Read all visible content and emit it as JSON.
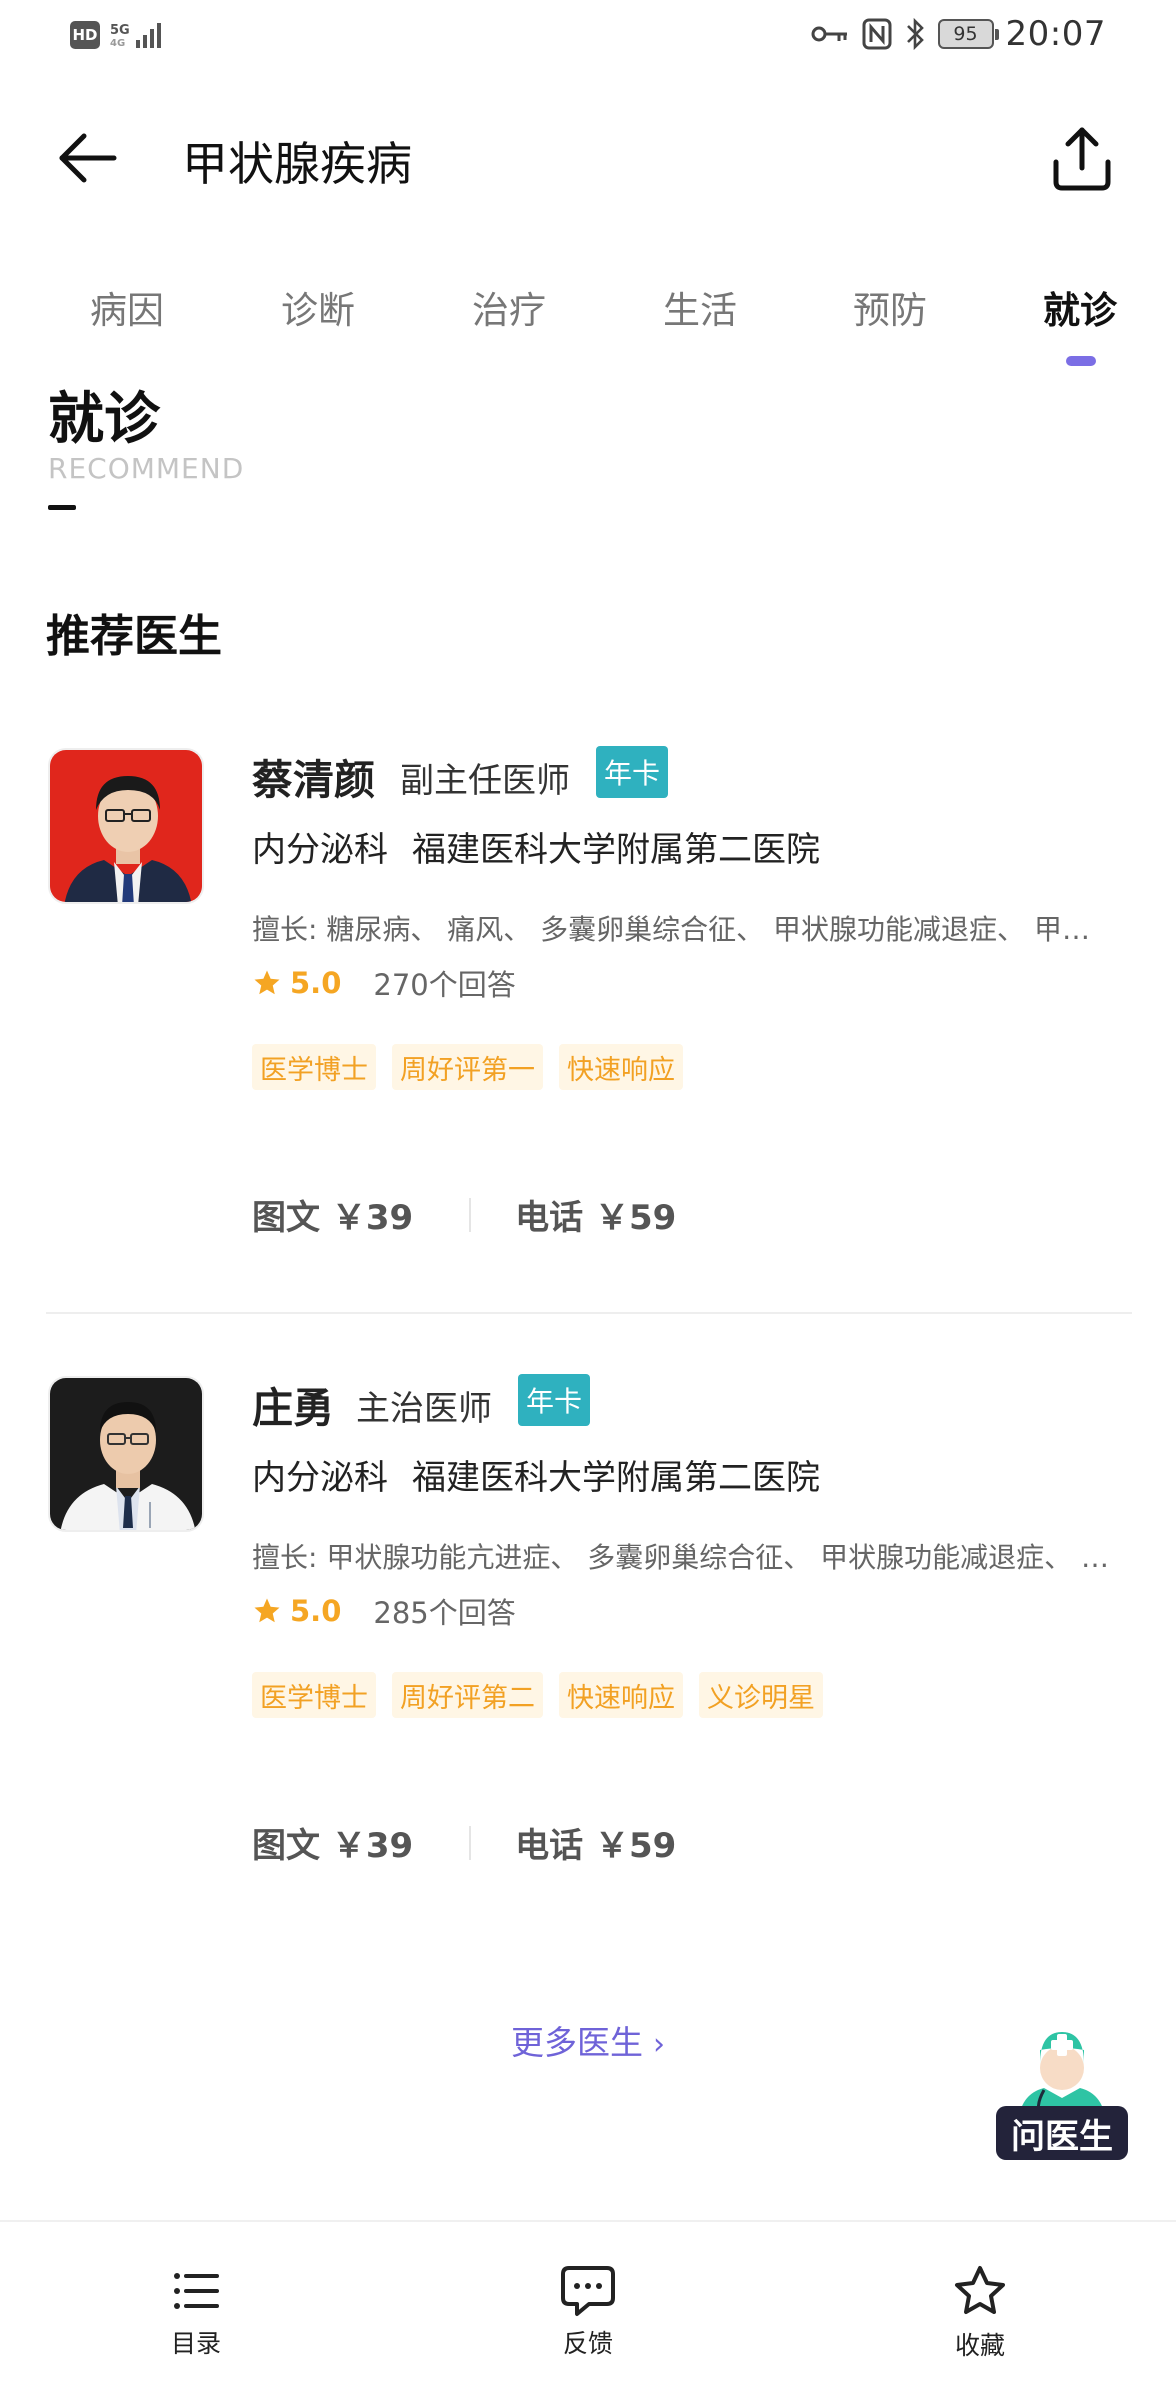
{
  "status_bar": {
    "hd": "HD",
    "network_top": "5G",
    "network_bottom": "4G",
    "battery": "95",
    "time": "20:07"
  },
  "header": {
    "title": "甲状腺疾病"
  },
  "tabs": [
    {
      "label": "病因",
      "active": false
    },
    {
      "label": "诊断",
      "active": false
    },
    {
      "label": "治疗",
      "active": false
    },
    {
      "label": "生活",
      "active": false
    },
    {
      "label": "预防",
      "active": false
    },
    {
      "label": "就诊",
      "active": true
    }
  ],
  "section": {
    "title": "就诊",
    "subtitle": "RECOMMEND",
    "recommend_title": "推荐医生"
  },
  "doctors": [
    {
      "name": "蔡清颜",
      "title": "副主任医师",
      "badge": "年卡",
      "department": "内分泌科",
      "hospital": "福建医科大学附属第二医院",
      "specialty": "擅长:   糖尿病、 痛风、 多囊卵巢综合征、 甲状腺功能减退症、 甲状腺功能亢进症",
      "rating": "5.0",
      "answers": "270个回答",
      "tags": [
        "医学博士",
        "周好评第一",
        "快速响应"
      ],
      "price_text": "图文 ￥39",
      "price_phone": "电话 ￥59",
      "avatar_bg": "#e0261c"
    },
    {
      "name": "庄勇",
      "title": "主治医师",
      "badge": "年卡",
      "department": "内分泌科",
      "hospital": "福建医科大学附属第二医院",
      "specialty": "擅长:   甲状腺功能亢进症、 多囊卵巢综合征、 甲状腺功能减退症、 糖尿病",
      "rating": "5.0",
      "answers": "285个回答",
      "tags": [
        "医学博士",
        "周好评第二",
        "快速响应",
        "义诊明星"
      ],
      "price_text": "图文 ￥39",
      "price_phone": "电话 ￥59",
      "avatar_bg": "#1c1c1c"
    }
  ],
  "more_doctors": "更多医生",
  "ask_doctor": "问医生",
  "bottom_nav": [
    {
      "label": "目录",
      "icon": "list-icon"
    },
    {
      "label": "反馈",
      "icon": "chat-bubble-icon"
    },
    {
      "label": "收藏",
      "icon": "star-outline-icon"
    }
  ],
  "colors": {
    "accent": "#7b6ee5",
    "badge": "#2fb1bf",
    "tag_text": "#f2a124",
    "tag_bg": "#fff6e5",
    "rating": "#f5a623"
  }
}
